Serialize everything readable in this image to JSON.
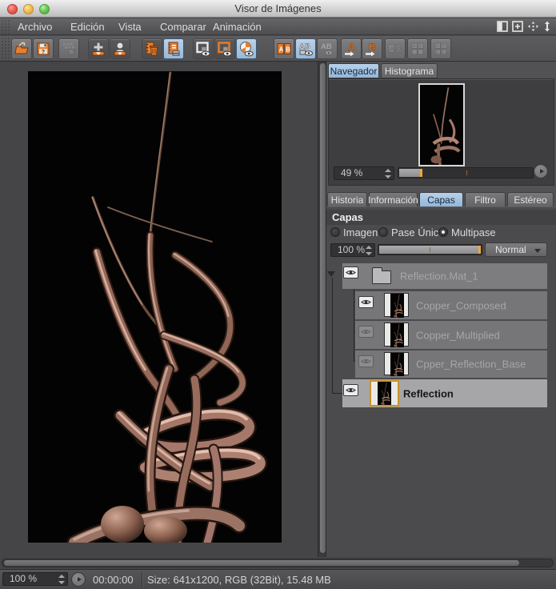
{
  "window": {
    "title": "Visor de Imágenes"
  },
  "menubar": {
    "items": [
      "Archivo",
      "Edición",
      "Vista",
      "Comparar",
      "Animación"
    ],
    "right_icons": [
      "split-view-icon",
      "add-panel-icon",
      "move-icon",
      "scale-vertical-icon"
    ]
  },
  "toolbar": {
    "icons": [
      {
        "name": "open-image",
        "state": "normal"
      },
      {
        "name": "save-image",
        "state": "normal"
      },
      {
        "name": "convert-x2",
        "state": "disabled"
      },
      {
        "name": "move-result-down",
        "state": "normal"
      },
      {
        "name": "move-user-down",
        "state": "normal"
      },
      {
        "name": "delete-from-manager",
        "state": "normal"
      },
      {
        "name": "layer-manager",
        "state": "active"
      },
      {
        "name": "show-frame-white",
        "state": "normal"
      },
      {
        "name": "show-frame-orange",
        "state": "normal"
      },
      {
        "name": "show-pie",
        "state": "active"
      },
      {
        "name": "compare-ab-split",
        "state": "normal"
      },
      {
        "name": "compare-ab-view",
        "state": "active"
      },
      {
        "name": "compare-ab-alt",
        "state": "disabled"
      },
      {
        "name": "set-as-a",
        "state": "normal"
      },
      {
        "name": "set-as-b",
        "state": "normal"
      },
      {
        "name": "swap-ab",
        "state": "disabled"
      },
      {
        "name": "grid-ab",
        "state": "disabled"
      },
      {
        "name": "numbered-ab",
        "state": "disabled"
      }
    ]
  },
  "navigator": {
    "tabs": [
      "Navegador",
      "Histograma"
    ],
    "active_tab": "Navegador",
    "zoom": "49 %"
  },
  "panel_tabs": {
    "items": [
      "Historia",
      "Información",
      "Capas",
      "Filtro",
      "Estéreo"
    ],
    "active": "Capas"
  },
  "layers": {
    "header": "Capas",
    "modes": [
      "Imagen",
      "Pase Único",
      "Multipase"
    ],
    "selected_mode": "Multipase",
    "opacity": "100 %",
    "blend_mode": "Normal",
    "rows": [
      {
        "label": "Reflection.Mat_1",
        "kind": "folder",
        "visible": true,
        "selected": false
      },
      {
        "label": "Copper_Composed",
        "kind": "pass",
        "visible": true,
        "selected": false
      },
      {
        "label": "Copper_Multiplied",
        "kind": "pass",
        "visible": false,
        "selected": false
      },
      {
        "label": "Cpper_Reflection_Base",
        "kind": "pass",
        "visible": false,
        "selected": false
      },
      {
        "label": "Reflection",
        "kind": "image",
        "visible": true,
        "selected": true
      }
    ]
  },
  "statusbar": {
    "zoom": "100 %",
    "time": "00:00:00",
    "info": "Size: 641x1200, RGB (32Bit), 15.48 MB"
  },
  "colors": {
    "accent_blue": "#a9c6e4",
    "accent_orange": "#e87e2e",
    "selection_border": "#c8922e"
  }
}
